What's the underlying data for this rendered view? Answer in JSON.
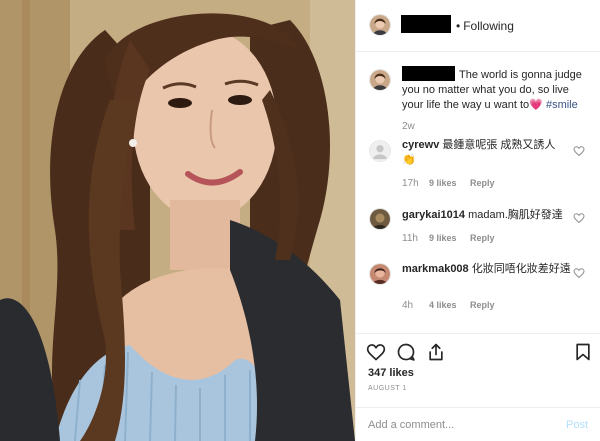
{
  "header": {
    "follow_status": "Following",
    "separator": "•"
  },
  "post": {
    "caption": "The world is gonna judge you no matter what you do, so live your life the way u want to",
    "caption_emoji": "💗",
    "hashtag": "#smile",
    "age": "2w",
    "likes": "347 likes",
    "date": "AUGUST 1"
  },
  "comments": [
    {
      "username": "cyrewv",
      "text": "最鍾意呢張 成熟又誘人",
      "emoji": "👏",
      "time": "17h",
      "likes": "9 likes",
      "reply": "Reply"
    },
    {
      "username": "garykai1014",
      "text": "madam.胸肌好發達",
      "emoji": "",
      "time": "11h",
      "likes": "9 likes",
      "reply": "Reply"
    },
    {
      "username": "markmak008",
      "text": "化妝同唔化妝差好遠",
      "emoji": "",
      "time": "4h",
      "likes": "4 likes",
      "reply": "Reply"
    }
  ],
  "composer": {
    "placeholder": "Add a comment...",
    "post_label": "Post"
  },
  "icons": {
    "like": "heart-outline-icon",
    "comment": "speech-bubble-icon",
    "share": "share-icon",
    "save": "bookmark-icon"
  },
  "colors": {
    "hashtag": "#385185",
    "post_button": "#b2dffc",
    "muted_text": "#8e8e8e",
    "border": "#efefef"
  }
}
